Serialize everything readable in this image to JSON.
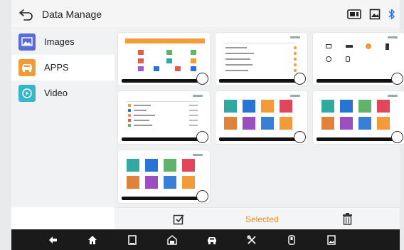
{
  "header": {
    "title": "Data Manage"
  },
  "sidebar": {
    "items": [
      {
        "label": "Images",
        "icon": "image-icon",
        "color": "#5b6bd6"
      },
      {
        "label": "APPS",
        "icon": "car-icon",
        "color": "#f29b38"
      },
      {
        "label": "Video",
        "icon": "play-icon",
        "color": "#35b7c9"
      }
    ],
    "active_index": 1
  },
  "actions": {
    "selected_label": "Selected"
  },
  "colors": {
    "accent": "#f08a24",
    "nav_bg": "#1a1a1a"
  }
}
